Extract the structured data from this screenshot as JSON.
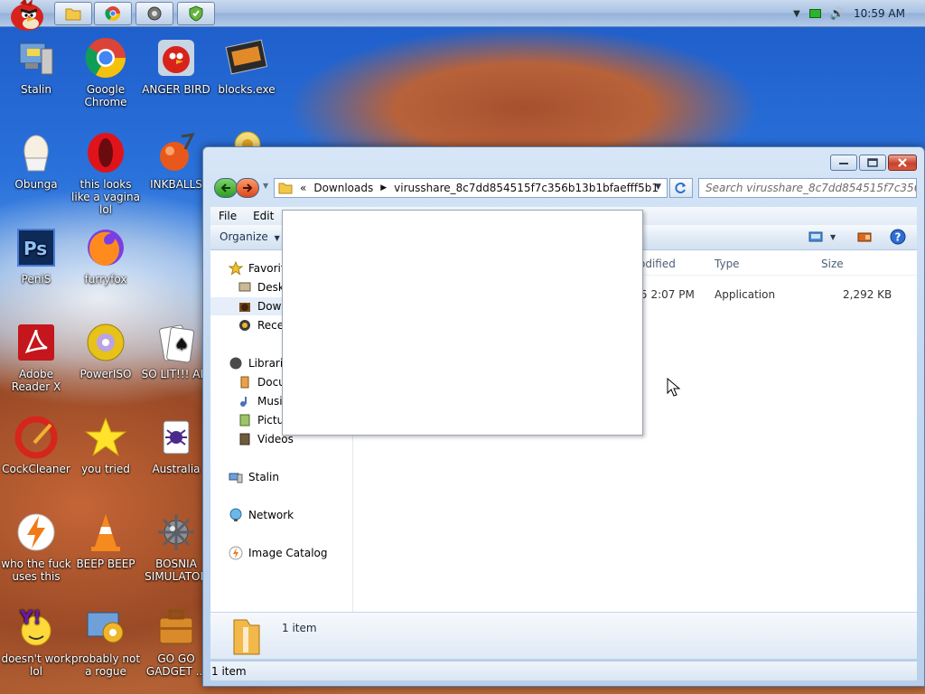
{
  "taskbar": {
    "clock": "10:59 AM"
  },
  "desktop": {
    "icons": [
      {
        "label": "Stalin"
      },
      {
        "label": "Google Chrome"
      },
      {
        "label": "ANGER BIRD"
      },
      {
        "label": "blocks.exe"
      },
      {
        "label": "Obunga"
      },
      {
        "label": "this looks like a vagina lol"
      },
      {
        "label": "INKBALLS"
      },
      {
        "label": "PeniS"
      },
      {
        "label": "furryfox"
      },
      {
        "label": "Adobe Reader X"
      },
      {
        "label": "PowerISO"
      },
      {
        "label": "SO LIT!!! AIR"
      },
      {
        "label": "CockCleaner"
      },
      {
        "label": "you tried"
      },
      {
        "label": "Australia"
      },
      {
        "label": "who the fuck uses this"
      },
      {
        "label": "BEEP BEEP"
      },
      {
        "label": "BOSNIA SIMULATOR"
      },
      {
        "label": "doesn't work lol"
      },
      {
        "label": "probably not a rogue"
      },
      {
        "label": "GO GO GADGET ..."
      }
    ]
  },
  "explorer": {
    "address": {
      "chevron": "«",
      "segment1": "Downloads",
      "segment2": "virusshare_8c7dd854515f7c356b13b1bfaefff5b1"
    },
    "search_placeholder": "Search virusshare_8c7dd854515f7c356...",
    "menu": {
      "file": "File",
      "edit": "Edit"
    },
    "organize": "Organize",
    "nav": {
      "favorites": "Favorite",
      "desktop": "Deskt",
      "downloads": "Down",
      "recent": "Recer",
      "libraries": "Librarie",
      "documents": "Docu",
      "music": "Music",
      "pictures": "Pictur",
      "videos": "Videos",
      "homegroup": "Stalin",
      "network": "Network",
      "image_catalog": "Image Catalog"
    },
    "columns": {
      "modified": "odified",
      "type": "Type",
      "size": "Size"
    },
    "rows": [
      {
        "modified": "5 2:07 PM",
        "type": "Application",
        "size": "2,292 KB"
      }
    ],
    "details_count": "1 item",
    "status_count": "1 item"
  },
  "colors": {
    "window_frame": "#c3d8f1",
    "selection": "#e5eef9",
    "close_button": "#c8412c"
  }
}
